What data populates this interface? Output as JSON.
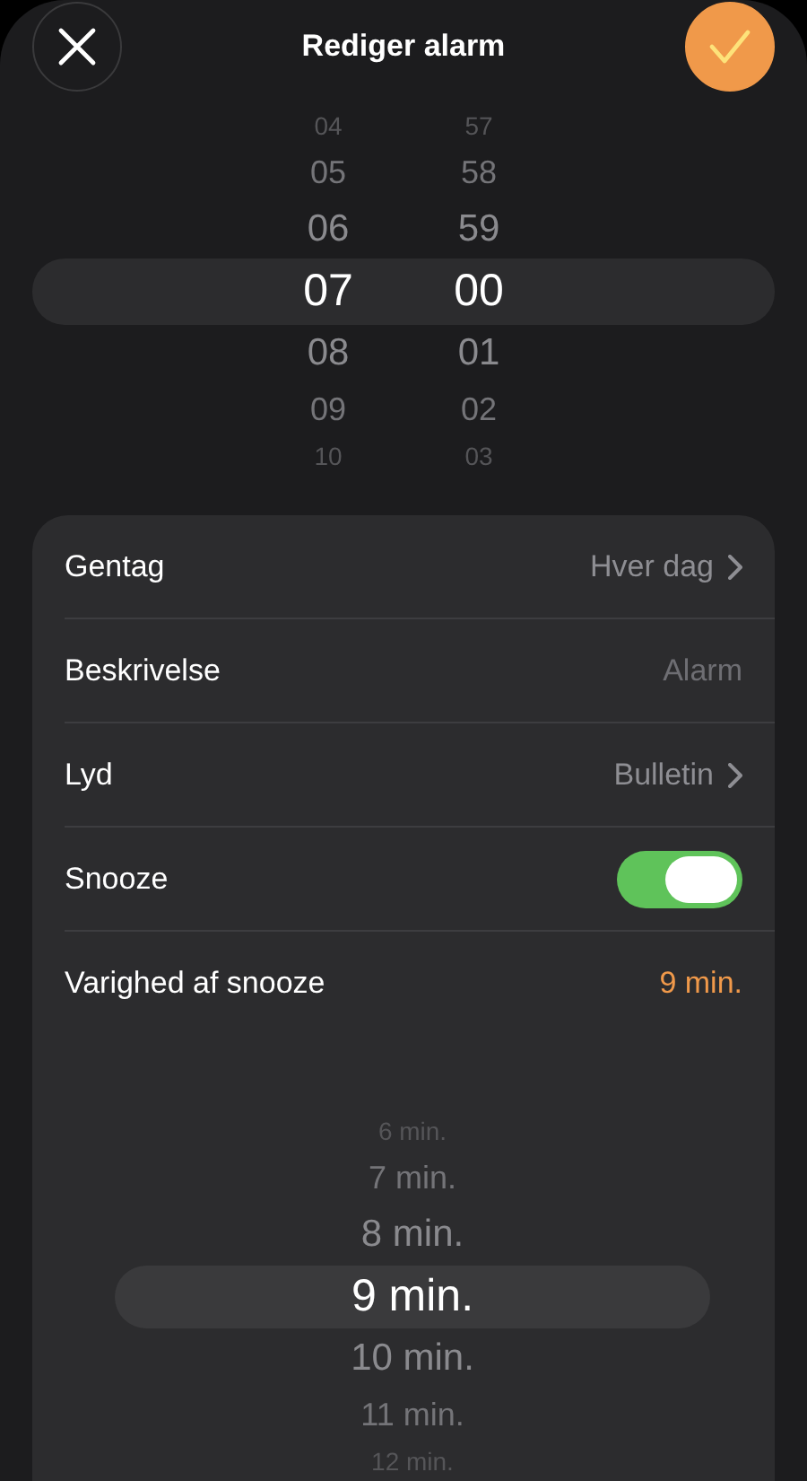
{
  "header": {
    "title": "Rediger alarm"
  },
  "time_picker": {
    "hours": [
      {
        "label": "04",
        "selected": false
      },
      {
        "label": "05",
        "selected": false
      },
      {
        "label": "06",
        "selected": false
      },
      {
        "label": "07",
        "selected": true
      },
      {
        "label": "08",
        "selected": false
      },
      {
        "label": "09",
        "selected": false
      },
      {
        "label": "10",
        "selected": false
      }
    ],
    "minutes": [
      {
        "label": "57",
        "selected": false
      },
      {
        "label": "58",
        "selected": false
      },
      {
        "label": "59",
        "selected": false
      },
      {
        "label": "00",
        "selected": true
      },
      {
        "label": "01",
        "selected": false
      },
      {
        "label": "02",
        "selected": false
      },
      {
        "label": "03",
        "selected": false
      }
    ]
  },
  "settings": [
    {
      "kind": "link",
      "label": "Gentag",
      "value": "Hver dag"
    },
    {
      "kind": "text",
      "label": "Beskrivelse",
      "placeholder": "Alarm"
    },
    {
      "kind": "link",
      "label": "Lyd",
      "value": "Bulletin"
    },
    {
      "kind": "toggle",
      "label": "Snooze",
      "on": true
    },
    {
      "kind": "value",
      "label": "Varighed af snooze",
      "value": "9 min."
    }
  ],
  "snooze_picker": [
    {
      "label": "6 min.",
      "selected": false
    },
    {
      "label": "7 min.",
      "selected": false
    },
    {
      "label": "8 min.",
      "selected": false
    },
    {
      "label": "9 min.",
      "selected": true
    },
    {
      "label": "10 min.",
      "selected": false
    },
    {
      "label": "11 min.",
      "selected": false
    },
    {
      "label": "12 min.",
      "selected": false
    }
  ]
}
